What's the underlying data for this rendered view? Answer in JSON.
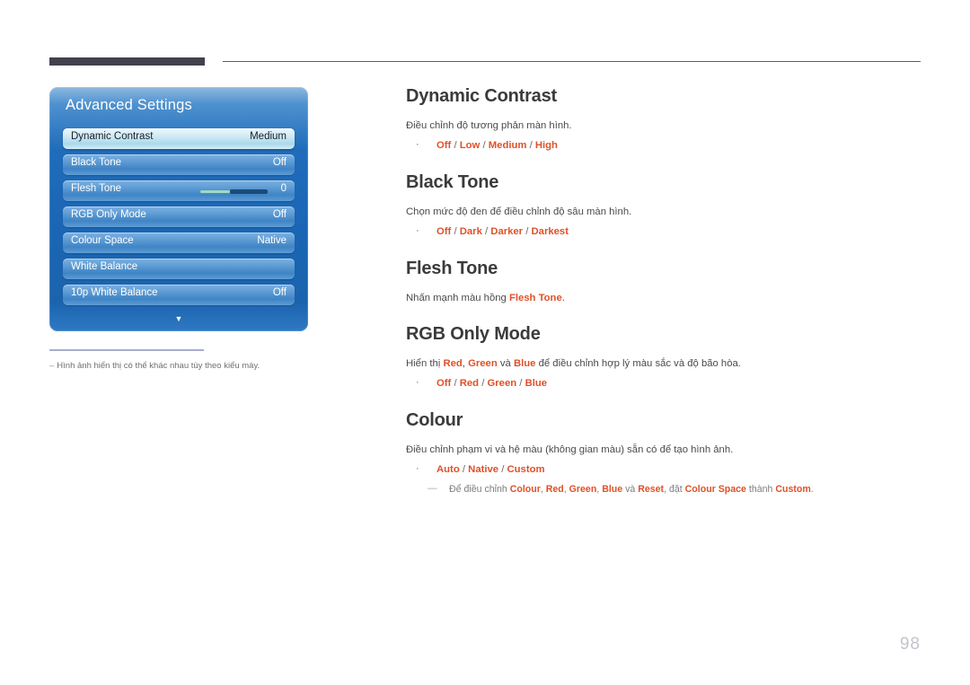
{
  "header": {
    "rule_left_color": "#43414e",
    "rule_right_color": "#5c5a66"
  },
  "menu": {
    "title": "Advanced Settings",
    "scroll_arrow": "▼",
    "items": [
      {
        "label": "Dynamic Contrast",
        "value": "Medium",
        "selected": true,
        "type": "value"
      },
      {
        "label": "Black Tone",
        "value": "Off",
        "selected": false,
        "type": "value"
      },
      {
        "label": "Flesh Tone",
        "value": "0",
        "selected": false,
        "type": "slider"
      },
      {
        "label": "RGB Only Mode",
        "value": "Off",
        "selected": false,
        "type": "value"
      },
      {
        "label": "Colour Space",
        "value": "Native",
        "selected": false,
        "type": "value"
      },
      {
        "label": "White Balance",
        "value": "",
        "selected": false,
        "type": "value"
      },
      {
        "label": "10p White Balance",
        "value": "Off",
        "selected": false,
        "type": "value"
      }
    ]
  },
  "footnote": {
    "dash": "‒",
    "text": "Hình ảnh hiển thị có thể khác nhau tùy theo kiểu máy."
  },
  "sections": [
    {
      "title": "Dynamic Contrast",
      "desc_plain": "Điều chỉnh độ tương phản màn hình.",
      "bullet": {
        "dot": "·",
        "options": [
          "Off",
          "Low",
          "Medium",
          "High"
        ],
        "separator": " / "
      }
    },
    {
      "title": "Black Tone",
      "desc_plain": "Chọn mức độ đen để điều chỉnh độ sâu màn hình.",
      "bullet": {
        "dot": "·",
        "options": [
          "Off",
          "Dark",
          "Darker",
          "Darkest"
        ],
        "separator": " / "
      }
    },
    {
      "title": "Flesh Tone",
      "desc_pre": "Nhấn mạnh màu hồng ",
      "desc_term": "Flesh Tone",
      "desc_post": "."
    },
    {
      "title": "RGB Only Mode",
      "desc_p1": "Hiển thị ",
      "desc_t1": "Red",
      "desc_p2": ", ",
      "desc_t2": "Green",
      "desc_p3": " và ",
      "desc_t3": "Blue",
      "desc_p4": " để điều chỉnh hợp lý màu sắc và độ bão hòa.",
      "bullet": {
        "dot": "·",
        "options": [
          "Off",
          "Red",
          "Green",
          "Blue"
        ],
        "separator": " / "
      }
    },
    {
      "title": "Colour",
      "desc_plain": "Điều chỉnh phạm vi và hệ màu (không gian màu) sẵn có để tạo hình ảnh.",
      "bullet": {
        "dot": "·",
        "options": [
          "Auto",
          "Native",
          "Custom"
        ],
        "separator": " / "
      },
      "subnote": {
        "dash": "—",
        "p1": "Để điều chỉnh ",
        "t1": "Colour",
        "p2": ", ",
        "t2": "Red",
        "p3": ", ",
        "t3": "Green",
        "p4": ", ",
        "t4": "Blue",
        "p5": " và ",
        "t5": "Reset",
        "p6": ", đặt ",
        "t6": "Colour Space",
        "p7": " thành ",
        "t7": "Custom",
        "p8": "."
      }
    }
  ],
  "page_number": "98",
  "colors": {
    "accent_orange": "#df5127",
    "heading": "#3b3b3b",
    "body": "#4a4a4a",
    "menu_blue": "#1f6cba"
  }
}
